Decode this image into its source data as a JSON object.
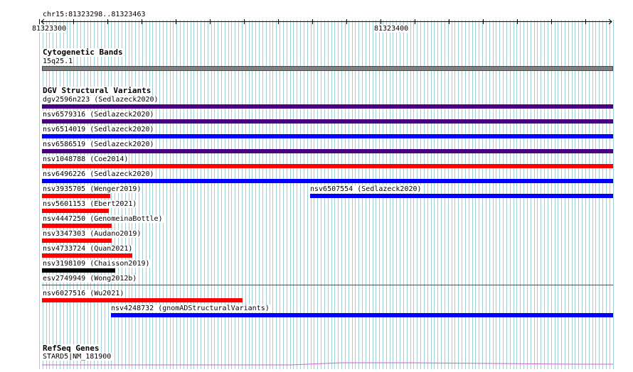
{
  "ruler": {
    "location": "chr15:81323298..81323463",
    "tick_start": "81323300",
    "tick_mid": "81323400"
  },
  "cytoband": {
    "title": "Cytogenetic Bands",
    "band_label": "15q25.1",
    "band_color": "#808080"
  },
  "dgv": {
    "title": "DGV Structural Variants",
    "features": [
      {
        "label": "dgv2596n223 (Sedlazeck2020)",
        "color": "#4b0082"
      },
      {
        "label": "nsv6579316 (Sedlazeck2020)",
        "color": "#4b0082"
      },
      {
        "label": "nsv6514019 (Sedlazeck2020)",
        "color": "#0000ff"
      },
      {
        "label": "nsv6586519 (Sedlazeck2020)",
        "color": "#4b0082"
      },
      {
        "label": "nsv1048788 (Coe2014)",
        "color": "#ff0000"
      },
      {
        "label": "nsv6496226 (Sedlazeck2020)",
        "color": "#0000ff"
      },
      {
        "label": "nsv3935705 (Wenger2019)",
        "color": "#ff0000"
      },
      {
        "label": "nsv6507554 (Sedlazeck2020)",
        "color": "#0000ff"
      },
      {
        "label": "nsv5601153 (Ebert2021)",
        "color": "#ff0000"
      },
      {
        "label": "nsv4447250 (GenomeinaBottle)",
        "color": "#ff0000"
      },
      {
        "label": "nsv3347303 (Audano2019)",
        "color": "#ff0000"
      },
      {
        "label": "nsv4733724 (Quan2021)",
        "color": "#ff0000"
      },
      {
        "label": "nsv3198109 (Chaisson2019)",
        "color": "#000000"
      },
      {
        "label": "esv2749949 (Wong2012b)",
        "color": "#ff0000"
      },
      {
        "label": "nsv6027516 (Wu2021)",
        "color": "#ff0000"
      },
      {
        "label": "nsv4248732 (gnomADStructuralVariants)",
        "color": "#0000ff"
      }
    ]
  },
  "refseq": {
    "title": "RefSeq Genes",
    "gene_label": "STARD5|NM_181900",
    "gene_color": "#cc66cc"
  },
  "colors": {
    "grid_line": "#9fd0d8",
    "ruler": "#000000"
  }
}
